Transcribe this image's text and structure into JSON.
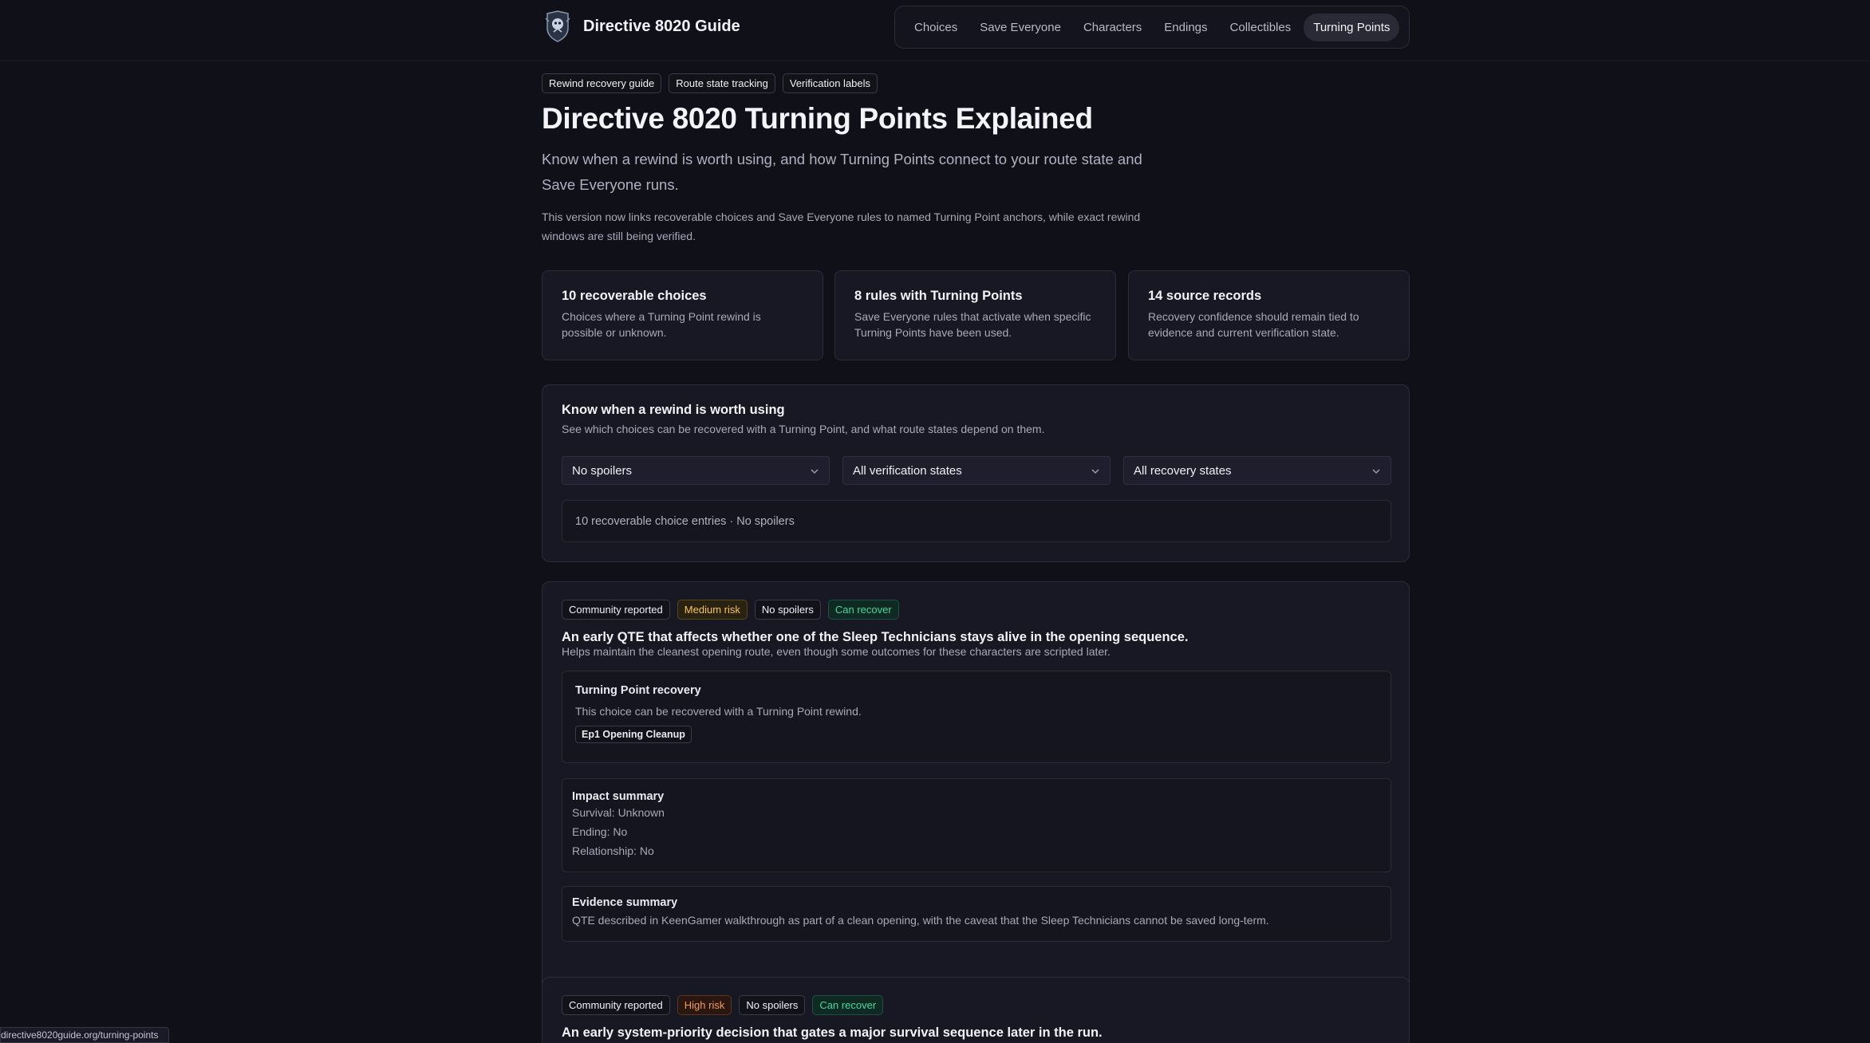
{
  "header": {
    "brand": "Directive 8020 Guide",
    "logo_icon": "crest-logo-icon",
    "nav": [
      {
        "label": "Choices",
        "active": false
      },
      {
        "label": "Save Everyone",
        "active": false
      },
      {
        "label": "Characters",
        "active": false
      },
      {
        "label": "Endings",
        "active": false
      },
      {
        "label": "Collectibles",
        "active": false
      },
      {
        "label": "Turning Points",
        "active": true
      }
    ]
  },
  "hero": {
    "chips": [
      "Rewind recovery guide",
      "Route state tracking",
      "Verification labels"
    ],
    "title": "Directive 8020 Turning Points Explained",
    "lead": "Know when a rewind is worth using, and how Turning Points connect to your route state and Save Everyone runs.",
    "note": "This version now links recoverable choices and Save Everyone rules to named Turning Point anchors, while exact rewind windows are still being verified."
  },
  "stats": [
    {
      "title": "10 recoverable choices",
      "desc": "Choices where a Turning Point rewind is possible or unknown."
    },
    {
      "title": "8 rules with Turning Points",
      "desc": "Save Everyone rules that activate when specific Turning Points have been used."
    },
    {
      "title": "14 source records",
      "desc": "Recovery confidence should remain tied to evidence and current verification state."
    }
  ],
  "filters": {
    "title": "Know when a rewind is worth using",
    "subtitle": "See which choices can be recovered with a Turning Point, and what route states depend on them.",
    "spoilers": "No spoilers",
    "verification": "All verification states",
    "recovery": "All recovery states",
    "results": "10 recoverable choice entries · No spoilers"
  },
  "cards": [
    {
      "tags": {
        "source": "Community reported",
        "risk": "Medium risk",
        "spoiler": "No spoilers",
        "recovery": "Can recover"
      },
      "title": "An early QTE that affects whether one of the Sleep Technicians stays alive in the opening sequence.",
      "subtitle": "Helps maintain the cleanest opening route, even though some outcomes for these characters are scripted later.",
      "recovery_title": "Turning Point recovery",
      "recovery_text": "This choice can be recovered with a Turning Point rewind.",
      "anchor": "Ep1 Opening Cleanup",
      "impact_title": "Impact summary",
      "impact": [
        "Survival: Unknown",
        "Ending: No",
        "Relationship: No"
      ],
      "evidence_title": "Evidence summary",
      "evidence": "QTE described in KeenGamer walkthrough as part of a clean opening, with the caveat that the Sleep Technicians cannot be saved long-term."
    },
    {
      "tags": {
        "source": "Community reported",
        "risk": "High risk",
        "spoiler": "No spoilers",
        "recovery": "Can recover"
      },
      "title": "An early system-priority decision that gates a major survival sequence later in the run."
    }
  ],
  "status_bar": {
    "url": "directive8020guide.org/turning-points"
  },
  "colors": {
    "accent_recover": "#45d6a0",
    "medium_risk": "#f5c453",
    "high_risk": "#f19a5a",
    "background": "#101019"
  }
}
